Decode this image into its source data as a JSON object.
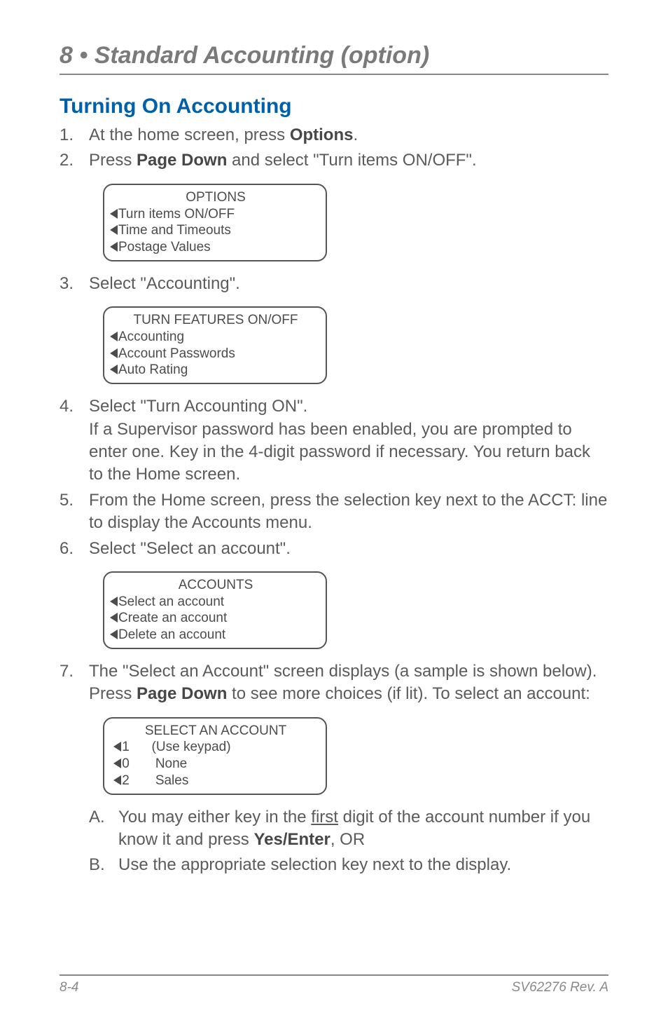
{
  "chapter": "8 • Standard Accounting (option)",
  "section": "Turning On Accounting",
  "steps": {
    "s1_pre": "At the home screen, press ",
    "s1_bold": "Options",
    "s1_post": ".",
    "s2_pre": "Press ",
    "s2_bold": "Page Down",
    "s2_post": " and select \"Turn items ON/OFF\".",
    "s3": "Select \"Accounting\".",
    "s4a": "Select \"Turn Accounting ON\".",
    "s4b": "If a Supervisor password has been enabled, you are prompted to enter one. Key in the 4-digit password if necessary. You return back to the Home screen.",
    "s5": "From the Home screen, press the selection key next to the ACCT: line to display the Accounts menu.",
    "s6": "Select \"Select an account\".",
    "s7_pre": "The \"Select an Account\" screen displays (a sample is shown below). Press ",
    "s7_bold": "Page Down",
    "s7_post": " to see more choices (if lit). To select an account:"
  },
  "screens": {
    "options": {
      "title": "OPTIONS",
      "r1": "Turn items ON/OFF",
      "r2": "Time and Timeouts",
      "r3": "Postage Values"
    },
    "turn": {
      "title": "TURN FEATURES ON/OFF",
      "r1": "Accounting",
      "r2": "Account Passwords",
      "r3": "Auto Rating"
    },
    "accounts": {
      "title": "ACCOUNTS",
      "r1": "Select an account",
      "r2": "Create an account",
      "r3": "Delete an account"
    },
    "select": {
      "title": "SELECT AN ACCOUNT",
      "r1k": "1",
      "r1v": "(Use keypad)",
      "r2k": "0",
      "r2v": "None",
      "r3k": "2",
      "r3v": "Sales"
    }
  },
  "sub": {
    "a_pre": "You may either key in the ",
    "a_u": "first",
    "a_mid": " digit of the account number if you know it and press ",
    "a_bold": "Yes/Enter",
    "a_post": ",  OR",
    "b": "Use the appropriate selection key next to the display."
  },
  "footer": {
    "left": "8-4",
    "right": "SV62276 Rev. A"
  }
}
